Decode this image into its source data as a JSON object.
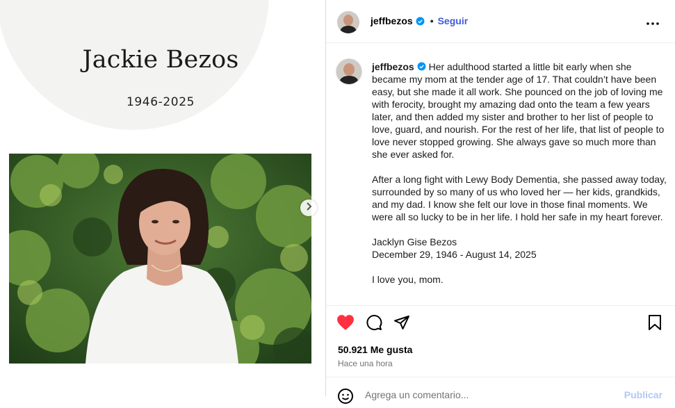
{
  "media": {
    "memorial_name": "Jackie Bezos",
    "memorial_years": "1946-2025",
    "next_icon": "chevron-right-icon"
  },
  "post": {
    "username": "jeffbezos",
    "verified": true,
    "follow_label": "Seguir",
    "dot": "•",
    "more_icon": "more-horizontal-icon",
    "caption_paragraphs": [
      "Her adulthood started a little bit early when she became my mom at the tender age of 17. That couldn’t have been easy, but she made it all work. She pounced on the job of loving me with ferocity, brought my amazing dad onto the team a few years later, and then added my sister and brother to her list of people to love, guard, and nourish. For the rest of her life, that list of people to love never stopped growing. She always gave so much more than she ever asked for.",
      "After a long fight with Lewy Body Dementia, she passed away today, surrounded by so many of us who loved her — her kids, grandkids, and my dad. I know she felt our love in those final moments. We were all so lucky to be in her life. I hold her safe in my heart forever.",
      "Jacklyn Gise Bezos\nDecember 29, 1946 - August 14, 2025",
      "I love you, mom."
    ],
    "likes": "50.921 Me gusta",
    "time": "Hace una hora",
    "comment_placeholder": "Agrega un comentario...",
    "publish_label": "Publicar"
  },
  "icons": {
    "like": "heart-filled-icon",
    "comment": "comment-icon",
    "share": "paper-plane-icon",
    "save": "bookmark-icon",
    "emoji": "emoji-icon"
  },
  "colors": {
    "like": "#ff3040",
    "verified": "#0095f6",
    "follow": "#3f5bd8",
    "publish_disabled": "#b3c7f7"
  }
}
